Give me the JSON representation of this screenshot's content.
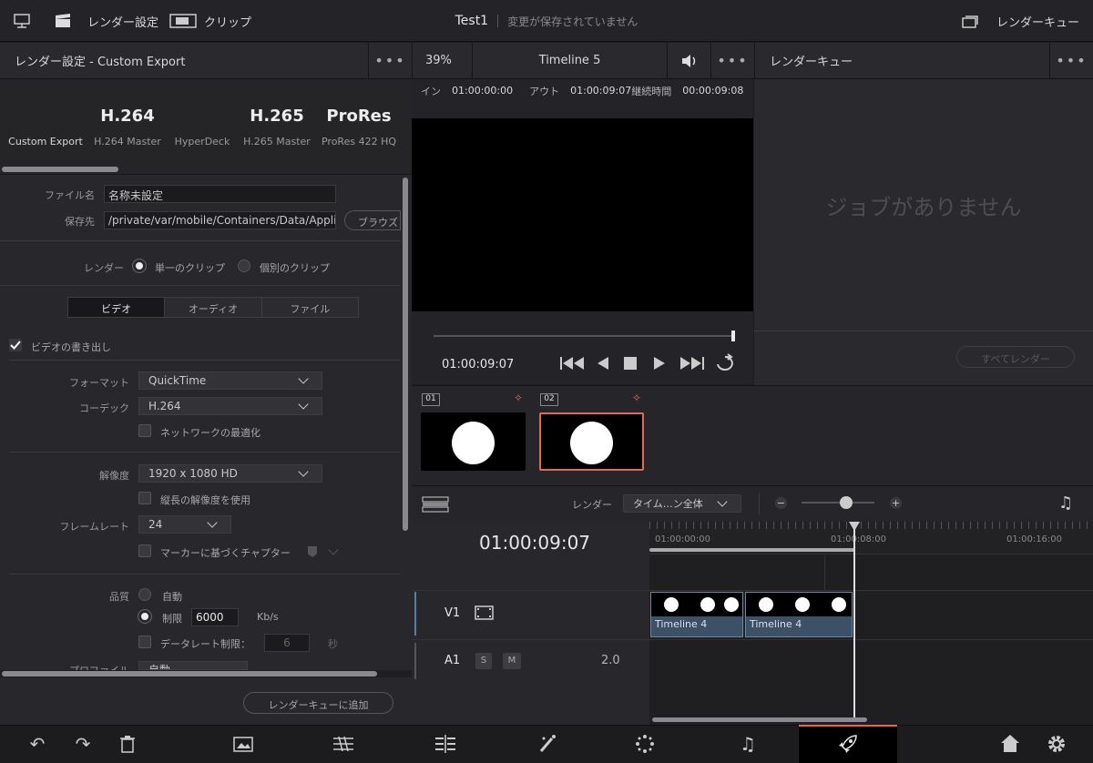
{
  "topbar": {
    "render_settings": "レンダー設定",
    "clip": "クリップ",
    "title": "Test1",
    "unsaved": "変更が保存されていません",
    "render_queue": "レンダーキュー"
  },
  "left_panel": {
    "header": "レンダー設定 - Custom Export",
    "presets": [
      {
        "big": "",
        "small": "Custom Export"
      },
      {
        "big": "H.264",
        "small": "H.264 Master"
      },
      {
        "big": "",
        "small": "HyperDeck"
      },
      {
        "big": "H.265",
        "small": "H.265 Master"
      },
      {
        "big": "ProRes",
        "small": "ProRes 422 HQ"
      }
    ],
    "filename_label": "ファイル名",
    "filename_value": "名称未設定",
    "location_label": "保存先",
    "location_value": "/private/var/mobile/Containers/Data/Applica",
    "browse": "ブラウズ",
    "render_label": "レンダー",
    "render_single": "単一のクリップ",
    "render_individual": "個別のクリップ",
    "tabs": [
      "ビデオ",
      "オーディオ",
      "ファイル"
    ],
    "export_video": "ビデオの書き出し",
    "format_label": "フォーマット",
    "format_value": "QuickTime",
    "codec_label": "コーデック",
    "codec_value": "H.264",
    "network_opt": "ネットワークの最適化",
    "resolution_label": "解像度",
    "resolution_value": "1920 x 1080 HD",
    "vertical_res": "縦長の解像度を使用",
    "framerate_label": "フレームレート",
    "framerate_value": "24",
    "chapters": "マーカーに基づくチャプター",
    "quality_label": "品質",
    "quality_auto": "自動",
    "quality_limit": "制限",
    "quality_value": "6000",
    "quality_unit": "Kb/s",
    "datarate_limit": "データレート制限：",
    "datarate_value": "6",
    "datarate_unit": "秒",
    "profile_label": "プロファイル",
    "profile_value": "自動",
    "add_to_queue": "レンダーキューに追加"
  },
  "viewer": {
    "zoom": "39%",
    "timeline": "Timeline 5",
    "in_label": "イン",
    "in_tc": "01:00:00:00",
    "out_label": "アウト",
    "out_tc": "01:00:09:07",
    "duration_label": "継続時間",
    "duration_tc": "00:00:09:08",
    "current_tc": "01:00:09:07"
  },
  "queue": {
    "header": "レンダーキュー",
    "empty": "ジョブがありません",
    "render_all": "すべてレンダー"
  },
  "bin": {
    "clips": [
      {
        "num": "01"
      },
      {
        "num": "02"
      }
    ]
  },
  "timeline": {
    "render_label": "レンダー",
    "render_range": "タイム…ン全体",
    "timecode": "01:00:09:07",
    "ruler": [
      "01:00:00:00",
      "01:00:08:00",
      "01:00:16:00"
    ],
    "v1": "V1",
    "a1": "A1",
    "s": "S",
    "m": "M",
    "level": "2.0",
    "clips": [
      "Timeline 4",
      "Timeline 4"
    ]
  }
}
